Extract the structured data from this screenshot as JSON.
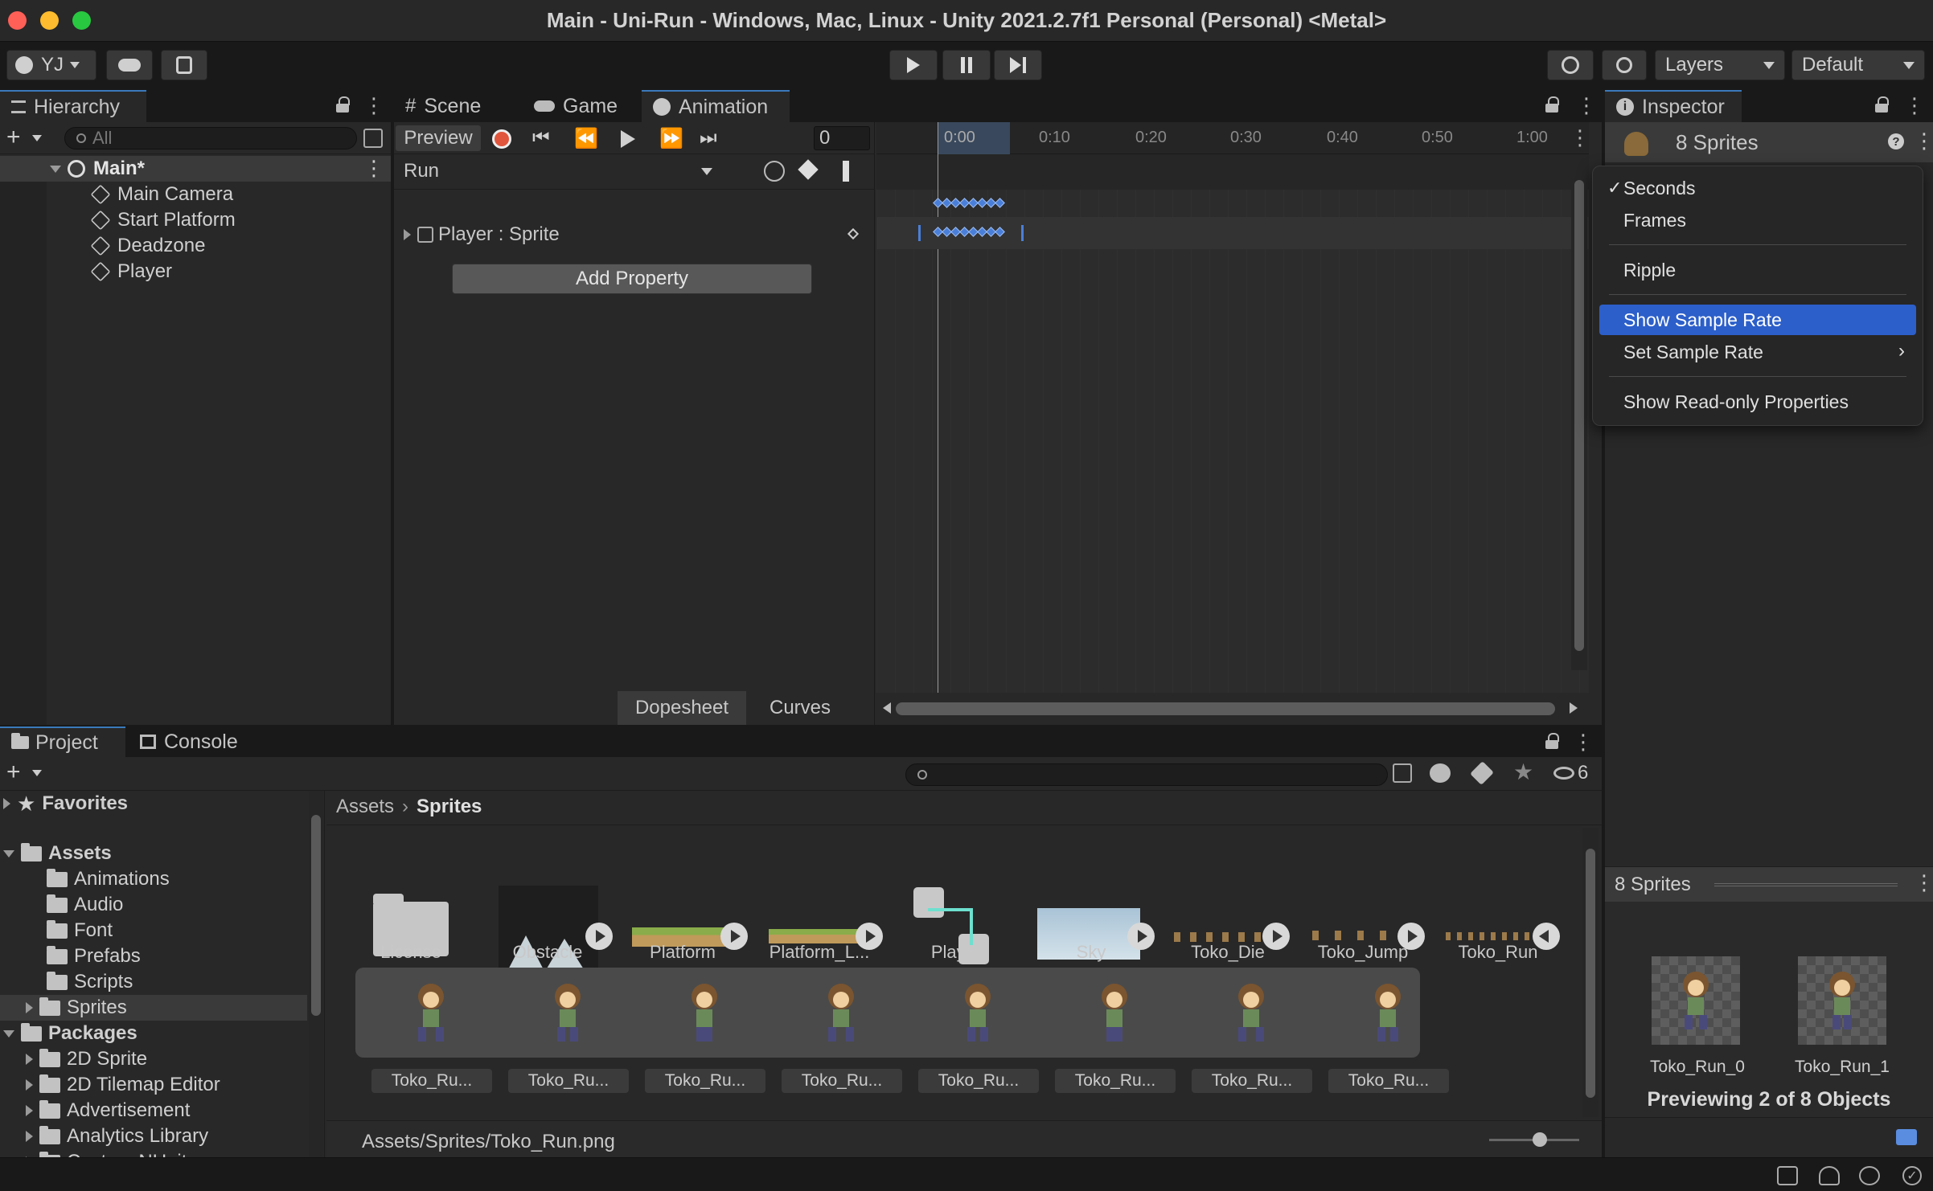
{
  "window": {
    "title": "Main - Uni-Run - Windows, Mac, Linux - Unity 2021.2.7f1 Personal (Personal) <Metal>"
  },
  "toolbar": {
    "account": "YJ",
    "layers": "Layers",
    "layout": "Default"
  },
  "hierarchy": {
    "tab": "Hierarchy",
    "search_placeholder": "All",
    "scene": "Main*",
    "objects": [
      "Main Camera",
      "Start Platform",
      "Deadzone",
      "Player"
    ]
  },
  "center_tabs": [
    "Scene",
    "Game",
    "Animation"
  ],
  "animation": {
    "preview": "Preview",
    "frame": "0",
    "clip": "Run",
    "property": "Player : Sprite",
    "add_property": "Add Property",
    "ruler": [
      "0:00",
      "0:10",
      "0:20",
      "0:30",
      "0:40",
      "0:50",
      "1:00"
    ],
    "modes": [
      "Dopesheet",
      "Curves"
    ]
  },
  "inspector": {
    "tab": "Inspector",
    "title": "8 Sprites",
    "preview_title": "8 Sprites",
    "previews": [
      "Toko_Run_0",
      "Toko_Run_1"
    ],
    "previewing": "Previewing 2 of 8 Objects"
  },
  "context_menu": {
    "items": [
      {
        "label": "Seconds",
        "checked": true
      },
      {
        "label": "Frames"
      },
      {
        "label": "Ripple"
      },
      {
        "label": "Show Sample Rate",
        "selected": true
      },
      {
        "label": "Set Sample Rate",
        "submenu": true
      },
      {
        "label": "Show Read-only Properties"
      }
    ]
  },
  "project": {
    "tabs": [
      "Project",
      "Console"
    ],
    "hidden_count": "6",
    "favorites": "Favorites",
    "assets_root": "Assets",
    "asset_folders": [
      "Animations",
      "Audio",
      "Font",
      "Prefabs",
      "Scripts",
      "Sprites"
    ],
    "packages_root": "Packages",
    "packages": [
      "2D Sprite",
      "2D Tilemap Editor",
      "Advertisement",
      "Analytics Library",
      "Custom NUnit"
    ],
    "breadcrumb": [
      "Assets",
      "Sprites"
    ],
    "assets": [
      "License",
      "Obstacle",
      "Platform",
      "Platform_L...",
      "Player",
      "Sky",
      "Toko_Die",
      "Toko_Jump",
      "Toko_Run"
    ],
    "sprites": [
      "Toko_Ru...",
      "Toko_Ru...",
      "Toko_Ru...",
      "Toko_Ru...",
      "Toko_Ru...",
      "Toko_Ru...",
      "Toko_Ru...",
      "Toko_Ru..."
    ],
    "path": "Assets/Sprites/Toko_Run.png"
  },
  "colors": {
    "accent": "#2c5fc9",
    "record": "#e0553c",
    "keyframe": "#4a7fd9"
  }
}
